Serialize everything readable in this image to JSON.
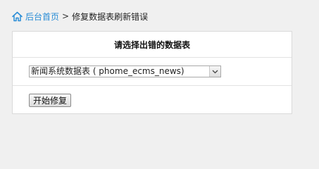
{
  "breadcrumb": {
    "home_label": "后台首页",
    "separator": ">",
    "current": "修复数据表刷新错误"
  },
  "panel": {
    "title": "请选择出错的数据表",
    "table_select": {
      "selected": "新闻系统数据表 ( phome_ecms_news)"
    },
    "repair_button_label": "开始修复"
  },
  "colors": {
    "link": "#2a8dd6",
    "background": "#f0f0f0",
    "panel_border": "#dadada"
  },
  "icons": {
    "home": "home-icon",
    "dropdown": "chevron-down-icon"
  }
}
